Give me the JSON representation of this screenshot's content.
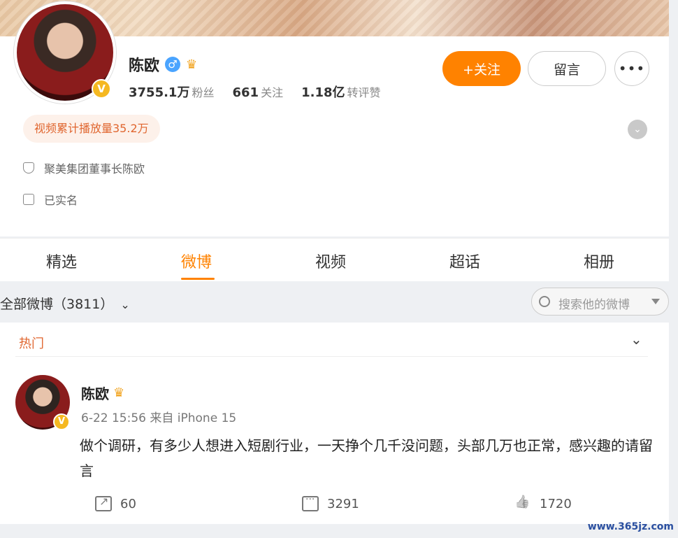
{
  "profile": {
    "name": "陈欧",
    "gender_icon": "male-icon",
    "stats": [
      {
        "value": "3755.1万",
        "label": "粉丝"
      },
      {
        "value": "661",
        "label": "关注"
      },
      {
        "value": "1.18亿",
        "label": "转评赞"
      }
    ],
    "follow_label": "+关注",
    "message_label": "留言",
    "more_label": "•••",
    "play_count_label": "视频累计播放量35.2万",
    "bio": "聚美集团董事长陈欧",
    "verification": "已实名",
    "verified_badge": "V"
  },
  "tabs": [
    {
      "label": "精选"
    },
    {
      "label": "微博"
    },
    {
      "label": "视频"
    },
    {
      "label": "超话"
    },
    {
      "label": "相册"
    }
  ],
  "active_tab": "微博",
  "filter": {
    "title": "全部微博（3811）",
    "search_placeholder": "搜索他的微博"
  },
  "feed": {
    "section_label": "热门",
    "post": {
      "author": "陈欧",
      "meta": "6-22 15:56 来自 iPhone 15",
      "text": "做个调研，有多少人想进入短剧行业，一天挣个几千没问题，头部几万也正常，感兴趣的请留言",
      "shares": "60",
      "comments": "3291",
      "likes": "1720"
    }
  },
  "watermark": "www.365jz.com",
  "colors": {
    "accent": "#ff8200",
    "hot": "#e0662f"
  }
}
